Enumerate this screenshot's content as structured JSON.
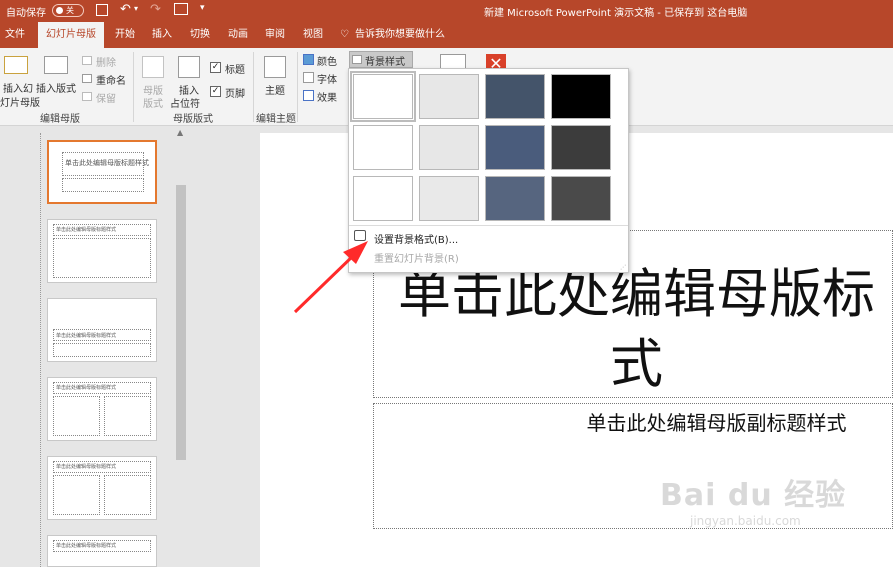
{
  "titlebar": {
    "autosave": "自动保存",
    "toggle": "关",
    "doc_title": "新建 Microsoft PowerPoint 演示文稿 - 已保存到 这台电脑"
  },
  "tabs": [
    "文件",
    "幻灯片母版",
    "开始",
    "插入",
    "切换",
    "动画",
    "审阅",
    "视图"
  ],
  "tell_me": "告诉我你想要做什么",
  "ribbon": {
    "insert_master": "插入幻灯片母版",
    "insert_master_l1": "插入幻",
    "insert_master_l2": "灯片母版",
    "insert_layout": "插入版式",
    "delete": "删除",
    "rename": "重命名",
    "preserve": "保留",
    "group_edit_master": "编辑母版",
    "master_layout_l1": "母版",
    "master_layout_l2": "版式",
    "insert_placeholder_l1": "插入",
    "insert_placeholder_l2": "占位符",
    "title_chk": "标题",
    "footer_chk": "页脚",
    "group_master_layout": "母版版式",
    "themes": "主题",
    "group_edit_theme": "编辑主题",
    "colors": "颜色",
    "fonts": "字体",
    "effects": "效果",
    "bg_styles": "背景样式"
  },
  "dropdown": {
    "format_bg": "设置背景格式(B)...",
    "reset_bg": "重置幻灯片背景(R)",
    "swatches": [
      "#ffffff",
      "#e7e7e7",
      "#44546a",
      "#000000",
      "#ffffff",
      "#e7e7e7",
      "#4a5c7c",
      "#3c3c3c",
      "#ffffff",
      "#e9e9e9",
      "#56657f",
      "#4a4a4a"
    ]
  },
  "slide": {
    "title_line1": "单击此处编辑母版标",
    "title_line2": "式",
    "subtitle": "单击此处编辑母版副标题样式"
  },
  "thumbnails": [
    {
      "title": "单击此处编辑母版标题样式",
      "selected": true
    },
    {
      "title": "单击此处编辑母版标题样式"
    },
    {
      "title": "单击此处编辑母版标题样式"
    },
    {
      "title": "单击此处编辑母版标题样式"
    },
    {
      "title": "单击此处编辑母版标题样式"
    },
    {
      "title": "单击此处编辑母版标题样式"
    }
  ],
  "watermark": {
    "brand": "Bai du 经验",
    "url": "jingyan.baidu.com"
  },
  "colors": {
    "accent": "#b7472a",
    "selection": "#e4782f",
    "arrow": "#ff2a2a"
  }
}
